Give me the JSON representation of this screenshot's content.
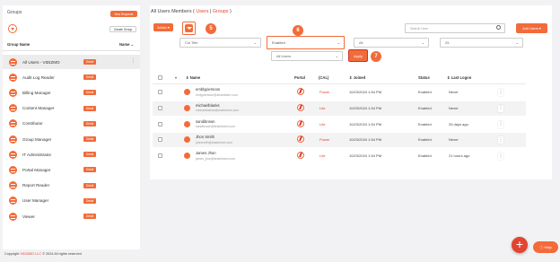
{
  "colors": {
    "accent": "#f26b3a",
    "accent_dark": "#e2442f",
    "background": "#f2f2f4"
  },
  "sidebar": {
    "title": "Groups",
    "new_requests_label": "New Requests",
    "create_group_label": "Create Group",
    "col_name": "Group Name",
    "col_name_sort": "Name ⌄",
    "items": [
      {
        "label": "All Users - VIDIZMO",
        "badge": "Detail",
        "selected": true
      },
      {
        "label": "Audit Log Reader",
        "badge": "Detail"
      },
      {
        "label": "Billing Manager",
        "badge": "Detail"
      },
      {
        "label": "Content Manager",
        "badge": "Detail"
      },
      {
        "label": "Contributor",
        "badge": "Detail"
      },
      {
        "label": "Group Manager",
        "badge": "Detail"
      },
      {
        "label": "IT Administrator",
        "badge": "Detail"
      },
      {
        "label": "Portal Manager",
        "badge": "Detail"
      },
      {
        "label": "Report Reader",
        "badge": "Detail"
      },
      {
        "label": "User Manager",
        "badge": "Detail"
      },
      {
        "label": "Viewer",
        "badge": "Detail"
      }
    ]
  },
  "main": {
    "breadcrumb_prefix": "All Users Members",
    "breadcrumb_users": "Users",
    "breadcrumb_sep": " | ",
    "breadcrumb_groups": "Groups",
    "actions_label": "Action",
    "filter_step": "5",
    "search_placeholder": "Search User",
    "add_users_label": "Add Users",
    "filters": {
      "col_title": "Col Title",
      "status": "Enabled",
      "all": "All",
      "page_size": "25",
      "all_users": "All Users",
      "apply_label": "Apply",
      "step6": "6",
      "step7": "7"
    },
    "table": {
      "col_name": "Name",
      "col_portal": "Portal",
      "col_cal": "(CAL)",
      "col_joined": "Joined",
      "col_status": "Status",
      "col_logon": "Last Logon",
      "rows": [
        {
          "name": "emblypiersoon",
          "email": "emlypiersoon@sharklearn.com",
          "cal": "Power",
          "joined": "10/23/2024 1:54 PM",
          "status": "Enabled",
          "logon": "Never"
        },
        {
          "name": "michaelblanks",
          "email": "michaelblanks@sharklearn.com",
          "cal": "Lite",
          "joined": "10/23/2024 1:54 PM",
          "status": "Enabled",
          "logon": "Never"
        },
        {
          "name": "sandibrown",
          "email": "sandibrown@sharklearn.com",
          "cal": "Lite",
          "joined": "10/23/2024 1:54 PM",
          "status": "Enabled",
          "logon": "33 days ago"
        },
        {
          "name": "Jhon Smith",
          "email": "johnsmith@sharklearn.com",
          "cal": "Power",
          "joined": "10/23/2024 1:54 PM",
          "status": "Enabled",
          "logon": "Never"
        },
        {
          "name": "James Jhon",
          "email": "james_jhon@sharklearn.com",
          "cal": "Lite",
          "joined": "10/23/2024 1:54 PM",
          "status": "Enabled",
          "logon": "21 hours ago"
        }
      ]
    }
  },
  "footer": {
    "copyright_prefix": "Copyright",
    "brand": "VIDIZMO LLC",
    "copyright_suffix": "© 2024 All rights reserved"
  },
  "help_label": "Help"
}
